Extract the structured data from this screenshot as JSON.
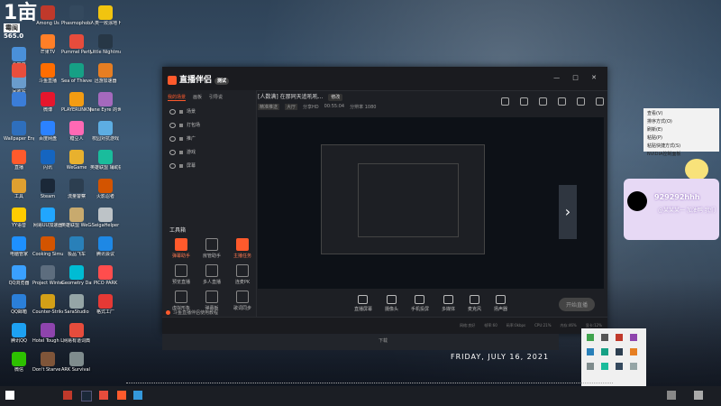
{
  "logo": {
    "big": "1亩",
    "sub": "霉闽",
    "num": "565.0"
  },
  "desktop_icons": [
    {
      "label": "此电脑",
      "color": "#4a90d9"
    },
    {
      "label": "回收站",
      "color": "#6a9ccc"
    },
    {
      "label": "",
      "color": "#e94e3c"
    },
    {
      "label": "",
      "color": "#3b7dd8"
    },
    {
      "label": "Wallpaper Engine",
      "color": "#2e6fbd"
    },
    {
      "label": "直播",
      "color": "#ff5a2c"
    },
    {
      "label": "工具",
      "color": "#e0a030"
    },
    {
      "label": "YY语音",
      "color": "#ffcc00"
    },
    {
      "label": "电脑管家",
      "color": "#1e90ff"
    },
    {
      "label": "QQ浏览器",
      "color": "#3aa0ff"
    },
    {
      "label": "QQ邮箱",
      "color": "#2b7fd8"
    },
    {
      "label": "腾讯QQ",
      "color": "#1da1f2"
    },
    {
      "label": "微信",
      "color": "#2dc100"
    },
    {
      "label": "Among Us",
      "color": "#c0392b"
    },
    {
      "label": "芒果TV",
      "color": "#ff7f27"
    },
    {
      "label": "斗鱼直播",
      "color": "#ff6d00"
    },
    {
      "label": "微博",
      "color": "#e6162d"
    },
    {
      "label": "百度网盘",
      "color": "#2b82ff"
    },
    {
      "label": "闪讯",
      "color": "#1565c0"
    },
    {
      "label": "Steam",
      "color": "#1b2838"
    },
    {
      "label": "网易UU加速器",
      "color": "#21a6ff"
    },
    {
      "label": "Cooking Simulator",
      "color": "#d35400"
    },
    {
      "label": "Project Winter",
      "color": "#5d6d7e"
    },
    {
      "label": "Counter-Strike Global Off...",
      "color": "#d4a017"
    },
    {
      "label": "Hotel Tough Life",
      "color": "#8e44ad"
    },
    {
      "label": "Don't Starve Together",
      "color": "#7f5539"
    },
    {
      "label": "Phasmophobia",
      "color": "#34495e"
    },
    {
      "label": "Pummel Party",
      "color": "#e74c3c"
    },
    {
      "label": "Sea of Thieves",
      "color": "#16a085"
    },
    {
      "label": "PLAYERUNKNOWN'S BATTLEGR...",
      "color": "#f39c12"
    },
    {
      "label": "糖豆人",
      "color": "#ff69b4"
    },
    {
      "label": "WeGame",
      "color": "#e8b12e"
    },
    {
      "label": "流量警察",
      "color": "#2c3e50"
    },
    {
      "label": "英雄联盟 WeGame版",
      "color": "#c8aa6e"
    },
    {
      "label": "极品飞车",
      "color": "#2980b9"
    },
    {
      "label": "Geometry Dash",
      "color": "#00bcd4"
    },
    {
      "label": "SaraStudio",
      "color": "#95a5a6"
    },
    {
      "label": "网易有道词典",
      "color": "#e74c3c"
    },
    {
      "label": "ARK Survival Evolved",
      "color": "#7f8c8d"
    },
    {
      "label": "人类一败涂地 Human Fa...",
      "color": "#f1c40f"
    },
    {
      "label": "Little Nightmares",
      "color": "#273746"
    },
    {
      "label": "迅游加速器",
      "color": "#e67e22"
    },
    {
      "label": "Jane Eyre 的世界",
      "color": "#a569bd"
    },
    {
      "label": "校园对抗游戏",
      "color": "#5dade2"
    },
    {
      "label": "英雄联盟 辅助插件",
      "color": "#1abc9c"
    },
    {
      "label": "火影忍者",
      "color": "#d35400"
    },
    {
      "label": "SeigaHelper",
      "color": "#bdc3c7"
    },
    {
      "label": "腾讯会议",
      "color": "#1e88e5"
    },
    {
      "label": "PICO PARK",
      "color": "#ff4d4d"
    },
    {
      "label": "格式工厂",
      "color": "#e53935"
    }
  ],
  "app": {
    "brand": "直播伴侣",
    "version": "测试",
    "window_controls": "— □ ✕",
    "tabs": [
      "我的场景",
      "画板",
      "引导说"
    ],
    "sources": [
      {
        "label": "场景"
      },
      {
        "label": "打包场"
      },
      {
        "label": "推广"
      },
      {
        "label": "游戏"
      },
      {
        "label": "屏幕"
      }
    ],
    "tools_title": "工具箱",
    "tools": [
      {
        "label": "弹幕助手",
        "hot": true
      },
      {
        "label": "房管助手",
        "hot": false
      },
      {
        "label": "主播任务",
        "hot": true
      },
      {
        "label": "预览直播",
        "hot": false
      },
      {
        "label": "多人直播",
        "hot": false
      },
      {
        "label": "连麦PK",
        "hot": false
      },
      {
        "label": "虚拟形象",
        "hot": false
      },
      {
        "label": "弹幕板",
        "hot": false
      },
      {
        "label": "歌词同步",
        "hot": false
      },
      {
        "label": "",
        "hot": false
      },
      {
        "label": "",
        "hot": false
      },
      {
        "label": "",
        "hot": false
      }
    ],
    "notice": "斗鱼直播伴侣使用教程",
    "header": {
      "title": "[人数满] 在那同天追吼吼...",
      "edit": "修改",
      "meta": [
        "精准推送",
        "大厅",
        "分享HD",
        "00:55:04",
        "分辨率 1080"
      ]
    },
    "controls": [
      "直播屏幕",
      "摄像头",
      "手机投屏",
      "多媒体",
      "麦克风",
      "扬声器"
    ],
    "go_live": "开始直播",
    "status": [
      "网络:良好",
      "帧率:60",
      "码率:0kbps",
      "CPU:21%",
      "内存:46%",
      "显卡:12%"
    ],
    "strip_text": "下载"
  },
  "context_menu": {
    "items": [
      "查看(V)",
      "排序方式(O)",
      "刷新(E)",
      "粘贴(P)",
      "粘贴快捷方式(S)",
      "NVIDIA控制面板"
    ]
  },
  "tiktok_card": {
    "id": "929292hhh",
    "sub": "@某某某一 加油鸭 我们"
  },
  "arrow": "›",
  "date": "FRIDAY, JULY 16, 2021"
}
